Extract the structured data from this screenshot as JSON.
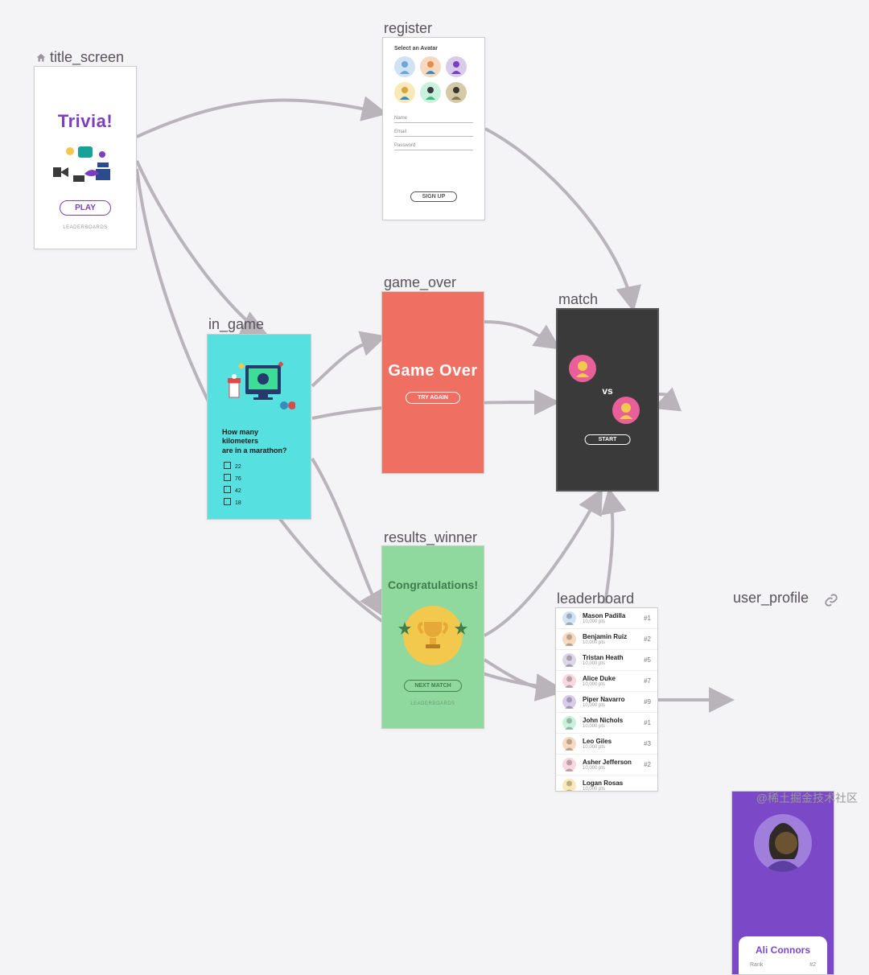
{
  "screens": {
    "title_screen": {
      "label": "title_screen",
      "title": "Trivia!",
      "play_button": "PLAY",
      "leaderboards_link": "LEADERBOARDS"
    },
    "register": {
      "label": "register",
      "heading": "Select an Avatar",
      "fields": {
        "name": "Name",
        "email": "Email",
        "password": "Password"
      },
      "signup_button": "SIGN UP",
      "avatar_colors": [
        "#cfe3f5",
        "#f7d9c0",
        "#d9cceb",
        "#f9e8b8",
        "#c9f2dd",
        "#d3cba7"
      ]
    },
    "in_game": {
      "label": "in_game",
      "question_line1": "How many kilometers",
      "question_line2": "are in a marathon?",
      "options": [
        "22",
        "76",
        "42",
        "18"
      ]
    },
    "game_over": {
      "label": "game_over",
      "title": "Game Over",
      "try_again_button": "TRY AGAIN"
    },
    "match": {
      "label": "match",
      "vs": "vs",
      "start_button": "START"
    },
    "results_winner": {
      "label": "results_winner",
      "title": "Congratulations!",
      "next_button": "NEXT MATCH",
      "leaderboards_link": "LEADERBOARDS"
    },
    "leaderboard": {
      "label": "leaderboard",
      "entries": [
        {
          "name": "Mason Padilla",
          "pts": "10,000 pts",
          "rank": "#1",
          "color": "#cfe3f5"
        },
        {
          "name": "Benjamin Ruiz",
          "pts": "10,000 pts",
          "rank": "#2",
          "color": "#f7d9c0"
        },
        {
          "name": "Tristan Heath",
          "pts": "10,000 pts",
          "rank": "#5",
          "color": "#ddd6e8"
        },
        {
          "name": "Alice Duke",
          "pts": "10,000 pts",
          "rank": "#7",
          "color": "#f9d7e0"
        },
        {
          "name": "Piper Navarro",
          "pts": "10,000 pts",
          "rank": "#9",
          "color": "#d9cceb"
        },
        {
          "name": "John Nichols",
          "pts": "10,000 pts",
          "rank": "#1",
          "color": "#c9f2dd"
        },
        {
          "name": "Leo Giles",
          "pts": "10,000 pts",
          "rank": "#3",
          "color": "#f7d9c0"
        },
        {
          "name": "Asher Jefferson",
          "pts": "10,000 pts",
          "rank": "#2",
          "color": "#f9d7e0"
        },
        {
          "name": "Logan Rosas",
          "pts": "10,000 pts",
          "rank": "",
          "color": "#f9e8b8"
        }
      ]
    },
    "user_profile": {
      "label": "user_profile",
      "name": "Ali Connors",
      "stat_label": "Rank",
      "stat_value": "#2"
    }
  },
  "edges": [
    [
      "title_screen",
      "register"
    ],
    [
      "title_screen",
      "in_game"
    ],
    [
      "title_screen",
      "leaderboard"
    ],
    [
      "register",
      "match"
    ],
    [
      "in_game",
      "game_over"
    ],
    [
      "in_game",
      "match"
    ],
    [
      "in_game",
      "results_winner"
    ],
    [
      "game_over",
      "match"
    ],
    [
      "results_winner",
      "match"
    ],
    [
      "results_winner",
      "leaderboard"
    ],
    [
      "leaderboard",
      "user_profile"
    ],
    [
      "leaderboard",
      "match"
    ]
  ],
  "watermark": "@稀土掘金技术社区"
}
